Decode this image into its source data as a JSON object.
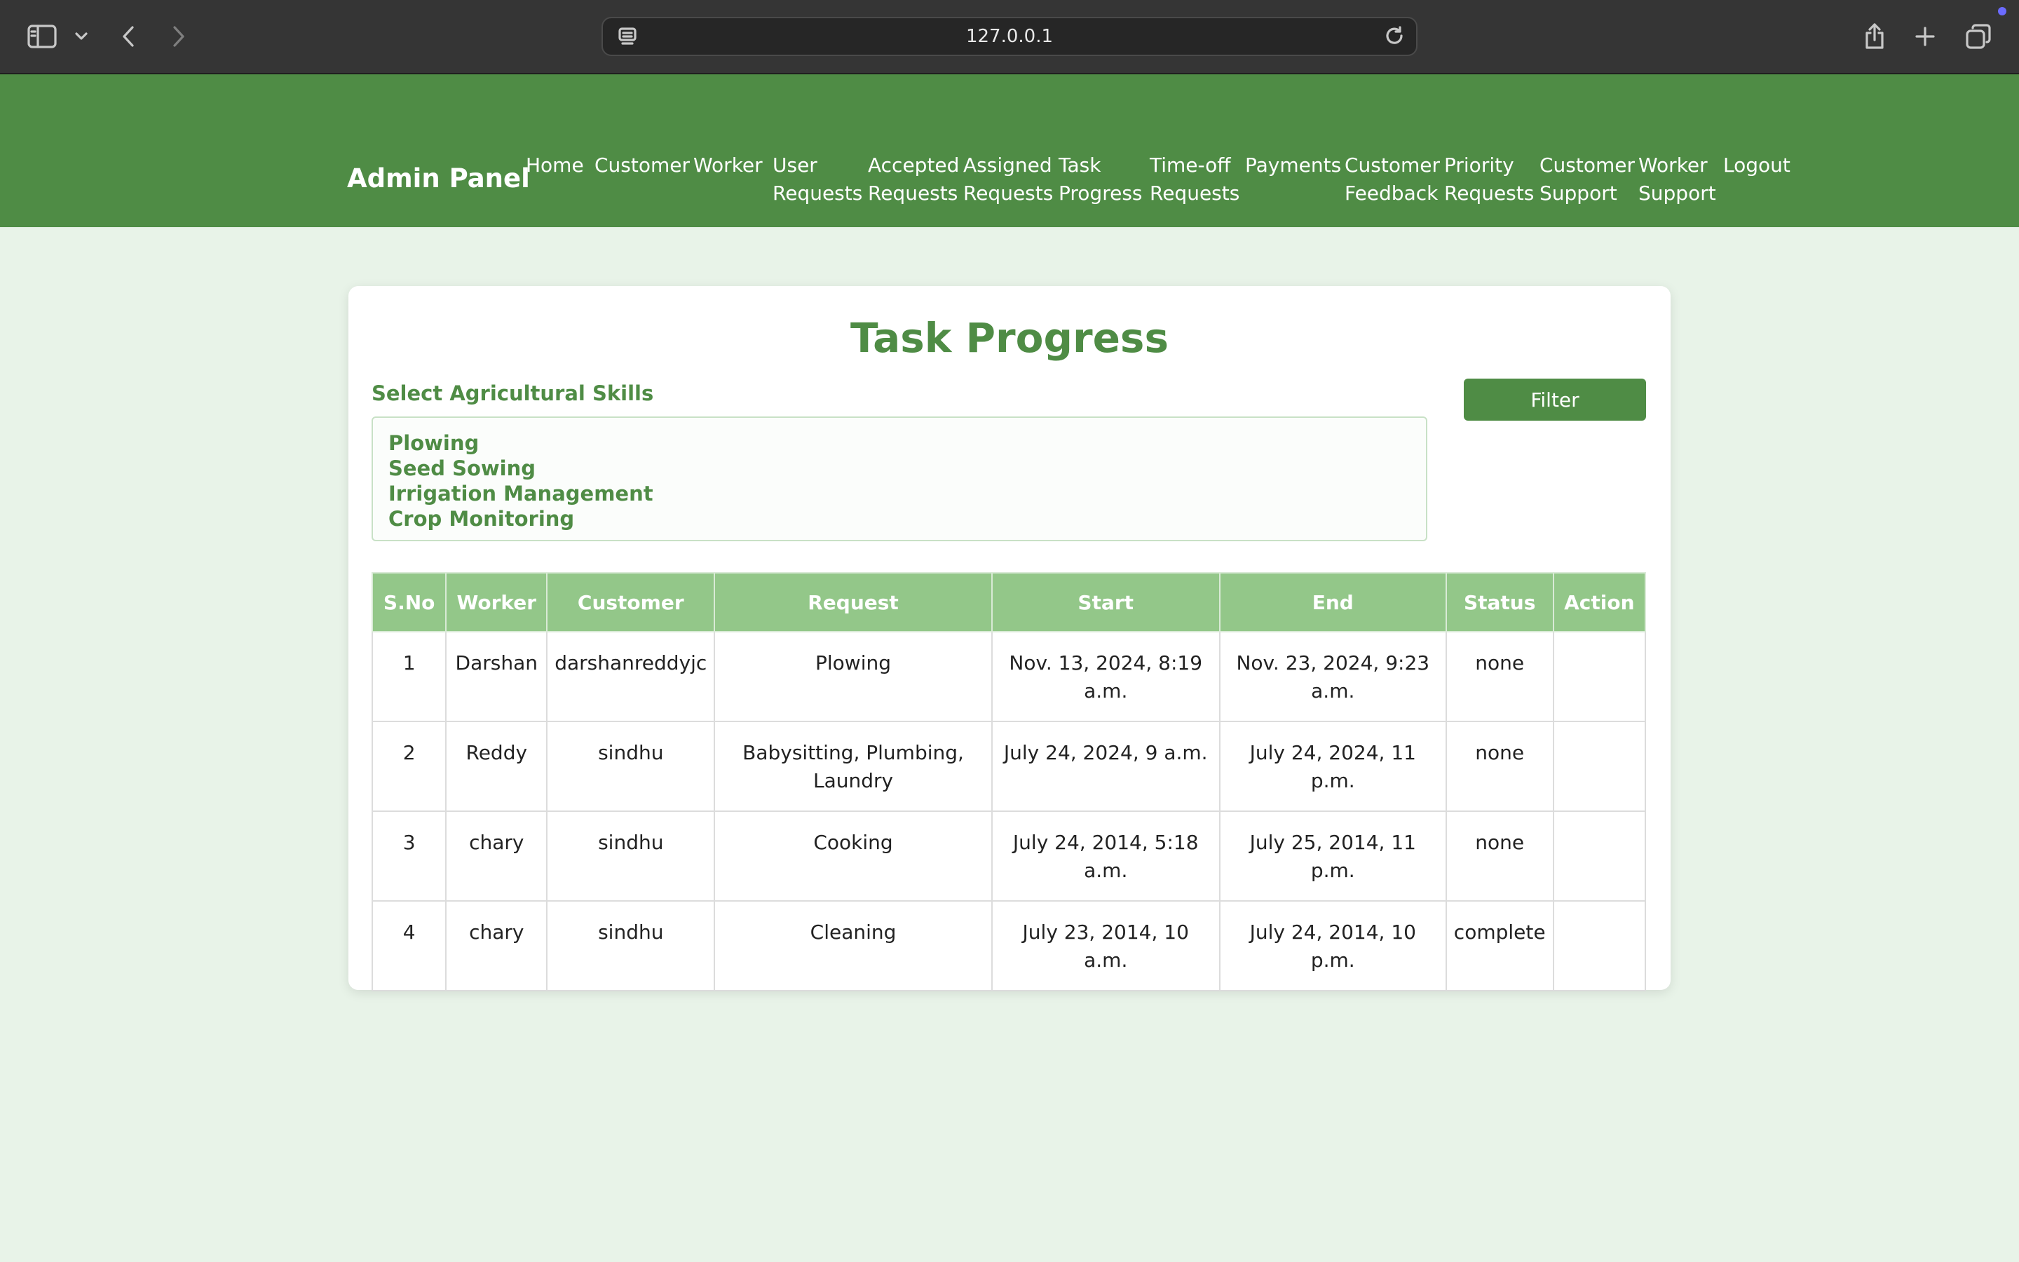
{
  "browser": {
    "url": "127.0.0.1"
  },
  "nav": {
    "brand": "Admin Panel",
    "links": [
      "Home",
      "Customer",
      "Worker",
      "User\nRequests",
      "Accepted\nRequests",
      "Assigned\nRequests",
      "Task\nProgress",
      "Time-off\nRequests",
      "Payments",
      "Customer\nFeedback",
      "Priority\nRequests",
      "Customer\nSupport",
      "Worker\nSupport",
      "Logout"
    ]
  },
  "page": {
    "title": "Task Progress",
    "skills_label": "Select Agricultural Skills",
    "skills": [
      "Plowing",
      "Seed Sowing",
      "Irrigation Management",
      "Crop Monitoring"
    ],
    "filter_label": "Filter"
  },
  "table": {
    "headers": [
      "S.No",
      "Worker",
      "Customer",
      "Request",
      "Start",
      "End",
      "Status",
      "Action"
    ],
    "rows": [
      [
        "1",
        "Darshan",
        "darshanreddyjc",
        "Plowing",
        "Nov. 13, 2024, 8:19 a.m.",
        "Nov. 23, 2024, 9:23 a.m.",
        "none",
        ""
      ],
      [
        "2",
        "Reddy",
        "sindhu",
        "Babysitting, Plumbing, Laundry",
        "July 24, 2024, 9 a.m.",
        "July 24, 2024, 11 p.m.",
        "none",
        ""
      ],
      [
        "3",
        "chary",
        "sindhu",
        "Cooking",
        "July 24, 2014, 5:18 a.m.",
        "July 25, 2014, 11 p.m.",
        "none",
        ""
      ],
      [
        "4",
        "chary",
        "sindhu",
        "Cleaning",
        "July 23, 2014, 10 a.m.",
        "July 24, 2014, 10 p.m.",
        "complete",
        ""
      ]
    ]
  }
}
